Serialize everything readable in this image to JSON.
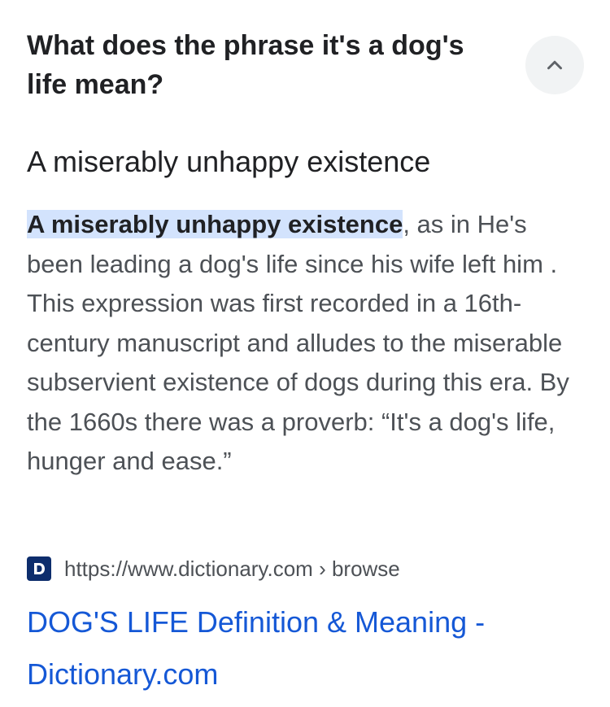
{
  "question": "What does the phrase it's a dog's life mean?",
  "answer": {
    "heading": "A miserably unhappy existence",
    "highlight": "A miserably unhappy existence",
    "snippet_rest": ", as in He's been leading a dog's life since his wife left him . This expression was first recorded in a 16th-century manuscript and alludes to the miserable subservient existence of dogs during this era. By the 1660s there was a proverb: “It's a dog's life, hunger and ease.”"
  },
  "source": {
    "favicon": "dictionary-com-icon",
    "url": "https://www.dictionary.com › browse"
  },
  "result": {
    "title": "DOG'S LIFE Definition & Meaning - Dictionary.com"
  },
  "icons": {
    "collapse": "chevron-up-icon"
  },
  "colors": {
    "highlight_bg": "#d3e3fd",
    "link": "#1558d6",
    "favicon_bg": "#0d2d6c"
  }
}
